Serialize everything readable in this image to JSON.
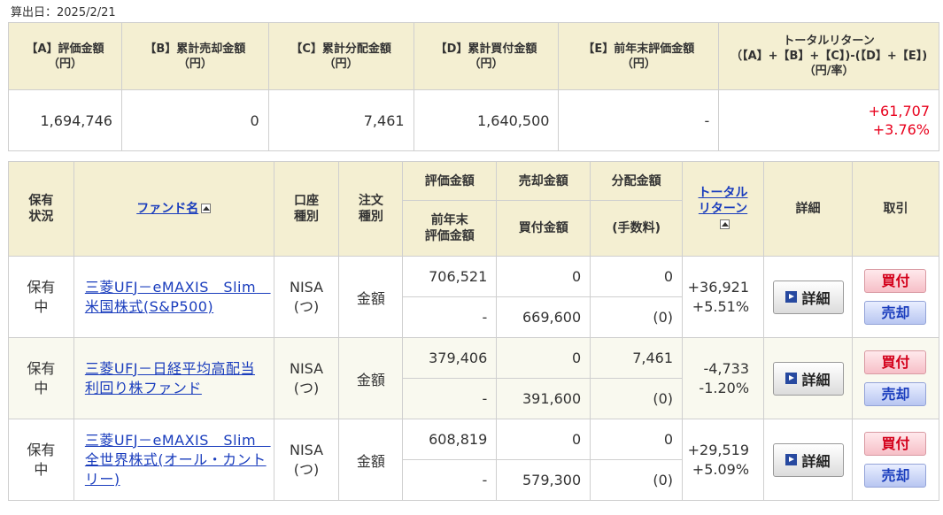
{
  "calc_date": "算出日：2025/2/21",
  "summary": {
    "headers": [
      [
        "【A】評価金額",
        "（円）"
      ],
      [
        "【B】累計売却金額",
        "（円）"
      ],
      [
        "【C】累計分配金額",
        "（円）"
      ],
      [
        "【D】累計買付金額",
        "（円）"
      ],
      [
        "【E】前年末評価金額",
        "（円）"
      ],
      [
        "トータルリターン",
        "（【A】+【B】+【C】)-(【D】+【E】)",
        "（円/率）"
      ]
    ],
    "values": {
      "a": "1,694,746",
      "b": "0",
      "c": "7,461",
      "d": "1,640,500",
      "e": "-",
      "total_yen": "+61,707",
      "total_pct": "+3.76%"
    }
  },
  "holdings": {
    "headers": {
      "status": [
        "保有",
        "状況"
      ],
      "fund_name": "ファンド名",
      "account": [
        "口座",
        "種別"
      ],
      "order": [
        "注文",
        "種別"
      ],
      "valuation": "評価金額",
      "sale": "売却金額",
      "distribution": "分配金額",
      "total_return": [
        "トータル",
        "リターン"
      ],
      "detail": "詳細",
      "trade": "取引",
      "prev_valuation": [
        "前年末",
        "評価金額"
      ],
      "purchase": "買付金額",
      "fee": "(手数料)"
    },
    "rows": [
      {
        "status": [
          "保有",
          "中"
        ],
        "fund": "三菱UFJ－eMAXIS　Slim　米国株式(S&P500)",
        "account": [
          "NISA",
          "(つ)"
        ],
        "order": "金額",
        "valuation": "706,521",
        "sale": "0",
        "distribution": "0",
        "prev_valuation": "-",
        "purchase": "669,600",
        "fee": "(0)",
        "return_yen": "+36,921",
        "return_pct": "+5.51%"
      },
      {
        "status": [
          "保有",
          "中"
        ],
        "fund": "三菱UFJ－日経平均高配当利回り株ファンド",
        "account": [
          "NISA",
          "(つ)"
        ],
        "order": "金額",
        "valuation": "379,406",
        "sale": "0",
        "distribution": "7,461",
        "prev_valuation": "-",
        "purchase": "391,600",
        "fee": "(0)",
        "return_yen": "-4,733",
        "return_pct": "-1.20%"
      },
      {
        "status": [
          "保有",
          "中"
        ],
        "fund": "三菱UFJ－eMAXIS　Slim　全世界株式(オール・カントリー)",
        "account": [
          "NISA",
          "(つ)"
        ],
        "order": "金額",
        "valuation": "608,819",
        "sale": "0",
        "distribution": "0",
        "prev_valuation": "-",
        "purchase": "579,300",
        "fee": "(0)",
        "return_yen": "+29,519",
        "return_pct": "+5.09%"
      }
    ]
  },
  "buttons": {
    "detail": "詳細",
    "buy": "買付",
    "sell": "売却"
  },
  "colors": {
    "header_bg": "#f4efd2",
    "positive": "#e8001c",
    "negative": "#1f2fd0",
    "link": "#1a3dbd"
  }
}
